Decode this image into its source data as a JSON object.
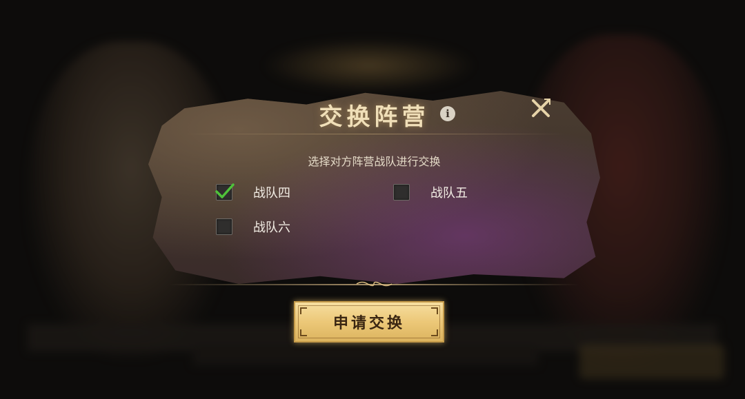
{
  "dialog": {
    "title": "交换阵营",
    "subtitle": "选择对方阵营战队进行交换"
  },
  "options": [
    {
      "label": "战队四",
      "checked": true
    },
    {
      "label": "战队五",
      "checked": false
    },
    {
      "label": "战队六",
      "checked": false
    }
  ],
  "apply_button": {
    "label": "申请交换"
  },
  "colors": {
    "title": "#f0dfb8",
    "check": "#4fc23a",
    "button": "#ecc878"
  },
  "icons": {
    "info": "info-icon",
    "close": "close-icon",
    "check": "checkmark-icon"
  }
}
